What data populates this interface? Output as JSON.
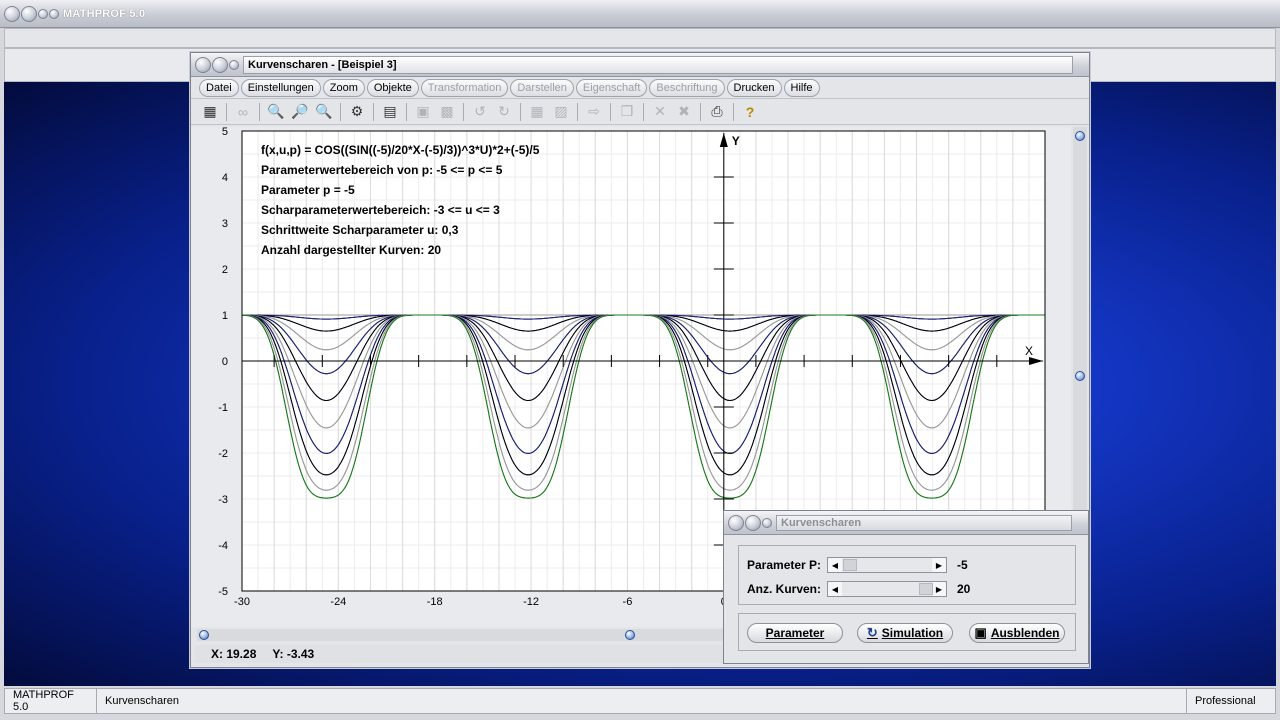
{
  "app": {
    "title": "MATHPROF 5.0",
    "status_left": "MATHPROF 5.0",
    "status_mid": "Kurvenscharen",
    "status_right": "Professional"
  },
  "window": {
    "title": "Kurvenscharen - [Beispiel 3]",
    "menu": [
      {
        "label": "Datei",
        "enabled": true
      },
      {
        "label": "Einstellungen",
        "enabled": true
      },
      {
        "label": "Zoom",
        "enabled": true
      },
      {
        "label": "Objekte",
        "enabled": true
      },
      {
        "label": "Transformation",
        "enabled": false
      },
      {
        "label": "Darstellen",
        "enabled": false
      },
      {
        "label": "Eigenschaft",
        "enabled": false
      },
      {
        "label": "Beschriftung",
        "enabled": false
      },
      {
        "label": "Drucken",
        "enabled": true
      },
      {
        "label": "Hilfe",
        "enabled": true
      }
    ],
    "coords": {
      "x": "X: 19.28",
      "y": "Y: -3.43"
    }
  },
  "info": [
    "f(x,u,p) = COS((SIN((-5)/20*X-(-5)/3))^3*U)*2+(-5)/5",
    "Parameterwertebereich von p: -5 <= p <= 5",
    "Parameter p = -5",
    "Scharparameterwertebereich: -3 <= u <= 3",
    "Schrittweite Scharparameter u: 0,3",
    "Anzahl dargestellter Kurven: 20"
  ],
  "axes": {
    "x_label": "X",
    "y_label": "Y",
    "x_ticks": [
      "-30",
      "-24",
      "-18",
      "-12",
      "-6",
      "0"
    ],
    "y_ticks": [
      "5",
      "4",
      "3",
      "2",
      "1",
      "0",
      "-1",
      "-2",
      "-3",
      "-4",
      "-5"
    ]
  },
  "dialog": {
    "title": "Kurvenscharen",
    "param_label": "Parameter P:",
    "param_value": "-5",
    "param_fraction": 0.0,
    "curves_label": "Anz. Kurven:",
    "curves_value": "20",
    "curves_fraction": 1.0,
    "btn_parameter": "Parameter",
    "btn_simulation": "Simulation",
    "btn_hide": "Ausblenden"
  },
  "chart_data": {
    "type": "line",
    "function": "f(x,u,p) = COS((SIN((-5)/20*X-(-5)/3))^3*U)*2+(-5)/5",
    "p": -5,
    "u_range": [
      -3,
      3
    ],
    "u_step": 0.3,
    "xlim": [
      -30,
      20
    ],
    "ylim": [
      -5,
      5
    ],
    "grid": true,
    "colors": [
      "#000000",
      "#9a9a9a",
      "#1a237e",
      "#1f7a1f"
    ]
  }
}
